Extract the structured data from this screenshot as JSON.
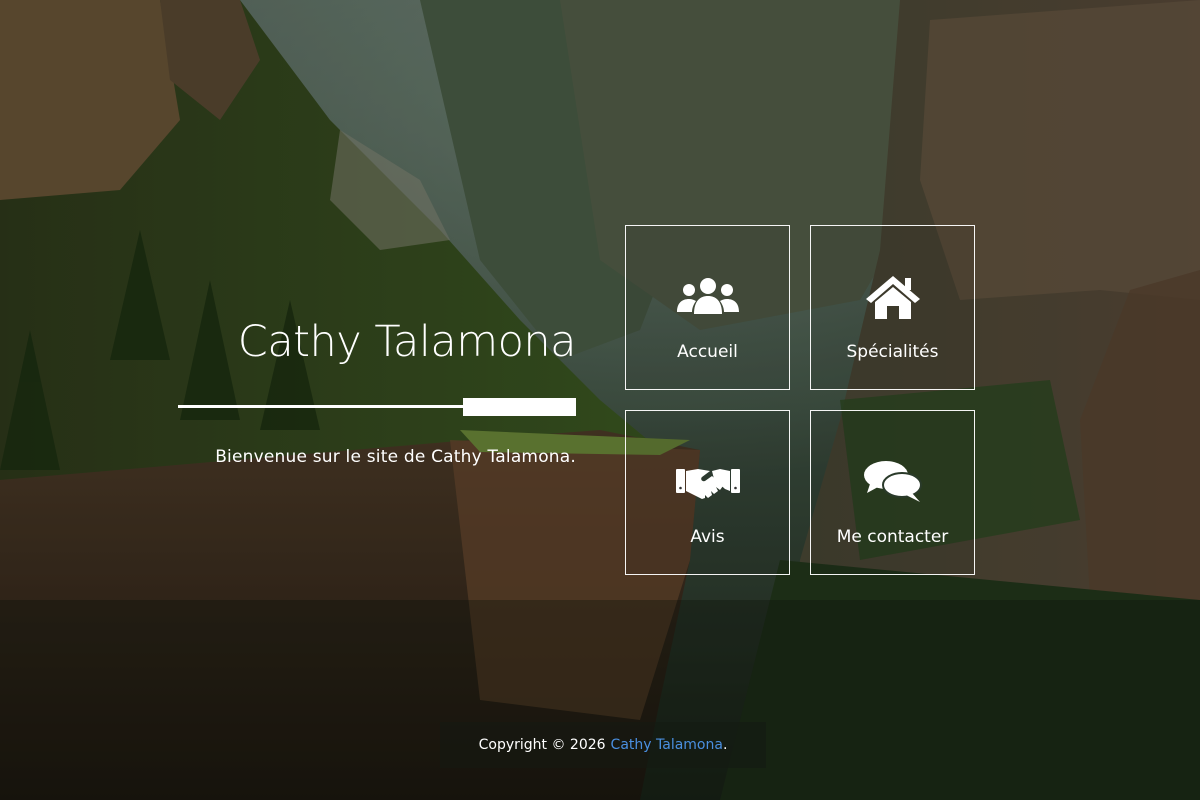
{
  "site": {
    "title": "Cathy Talamona",
    "subtitle": "Bienvenue sur le site de Cathy Talamona."
  },
  "tiles": [
    {
      "label": "Accueil",
      "icon": "users-group-icon"
    },
    {
      "label": "Spécialités",
      "icon": "home-icon"
    },
    {
      "label": "Avis",
      "icon": "handshake-icon"
    },
    {
      "label": "Me contacter",
      "icon": "chat-bubbles-icon"
    }
  ],
  "footer": {
    "copyright": "Copyright © 2026",
    "link_text": "Cathy Talamona",
    "period": "."
  },
  "colors": {
    "text": "#ffffff",
    "link": "#4a8fe0",
    "tile_border": "#ffffff"
  }
}
